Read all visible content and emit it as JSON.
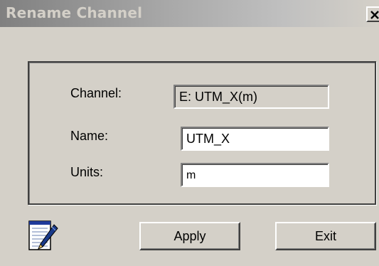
{
  "window": {
    "title": "Rename Channel",
    "close_icon": "close-icon"
  },
  "form": {
    "channel_label": "Channel:",
    "channel_value": "E: UTM_X(m)",
    "name_label": "Name:",
    "name_value": "UTM_X",
    "units_label": "Units:",
    "units_value": "m"
  },
  "buttons": {
    "apply_label": "Apply",
    "exit_label": "Exit"
  },
  "icons": {
    "edit": "notepad-pen-icon"
  }
}
